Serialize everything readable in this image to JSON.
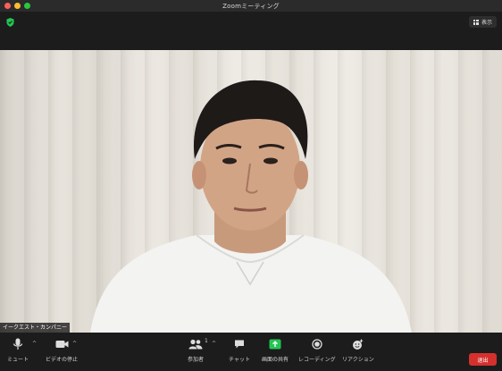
{
  "window": {
    "title": "Zoomミーティング"
  },
  "topbar": {
    "view_label": "表示"
  },
  "video": {
    "participant_name": "イークエスト・カンパニー"
  },
  "toolbar": {
    "mute_label": "ミュート",
    "stop_video_label": "ビデオの停止",
    "participants_label": "参加者",
    "participants_count": "1",
    "chat_label": "チャット",
    "share_screen_label": "画面の共有",
    "recording_label": "レコーディング",
    "reactions_label": "リアクション",
    "end_label": "退出"
  },
  "colors": {
    "accent_green": "#23c552",
    "end_red": "#d4312e",
    "bar_bg": "#1c1c1c"
  }
}
